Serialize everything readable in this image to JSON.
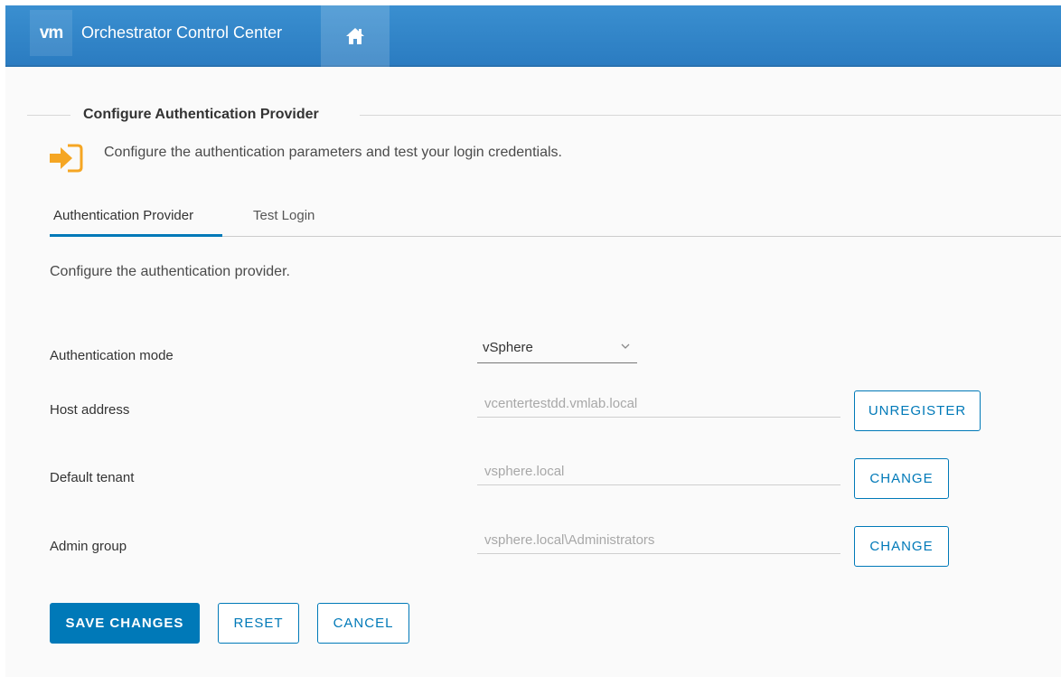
{
  "header": {
    "logo_text": "vm",
    "app_title": "Orchestrator Control Center",
    "home_icon": "home-icon",
    "bar_color": "#2b7cc1"
  },
  "page": {
    "title": "Configure Authentication Provider",
    "intro_icon": "login-arrow-icon",
    "intro_icon_color": "#f5a623",
    "intro_text": "Configure the authentication parameters and test your login credentials."
  },
  "tabs": [
    {
      "label": "Authentication Provider",
      "active": true
    },
    {
      "label": "Test Login",
      "active": false
    }
  ],
  "form": {
    "description": "Configure the authentication provider.",
    "auth_mode": {
      "label": "Authentication mode",
      "value": "vSphere"
    },
    "host_address": {
      "label": "Host address",
      "value": "vcentertestdd.vmlab.local",
      "button": "UNREGISTER"
    },
    "default_tenant": {
      "label": "Default tenant",
      "value": "vsphere.local",
      "button": "CHANGE"
    },
    "admin_group": {
      "label": "Admin group",
      "value": "vsphere.local\\Administrators",
      "button": "CHANGE"
    }
  },
  "actions": {
    "save": "SAVE CHANGES",
    "reset": "RESET",
    "cancel": "CANCEL"
  },
  "colors": {
    "accent": "#0079b8"
  }
}
